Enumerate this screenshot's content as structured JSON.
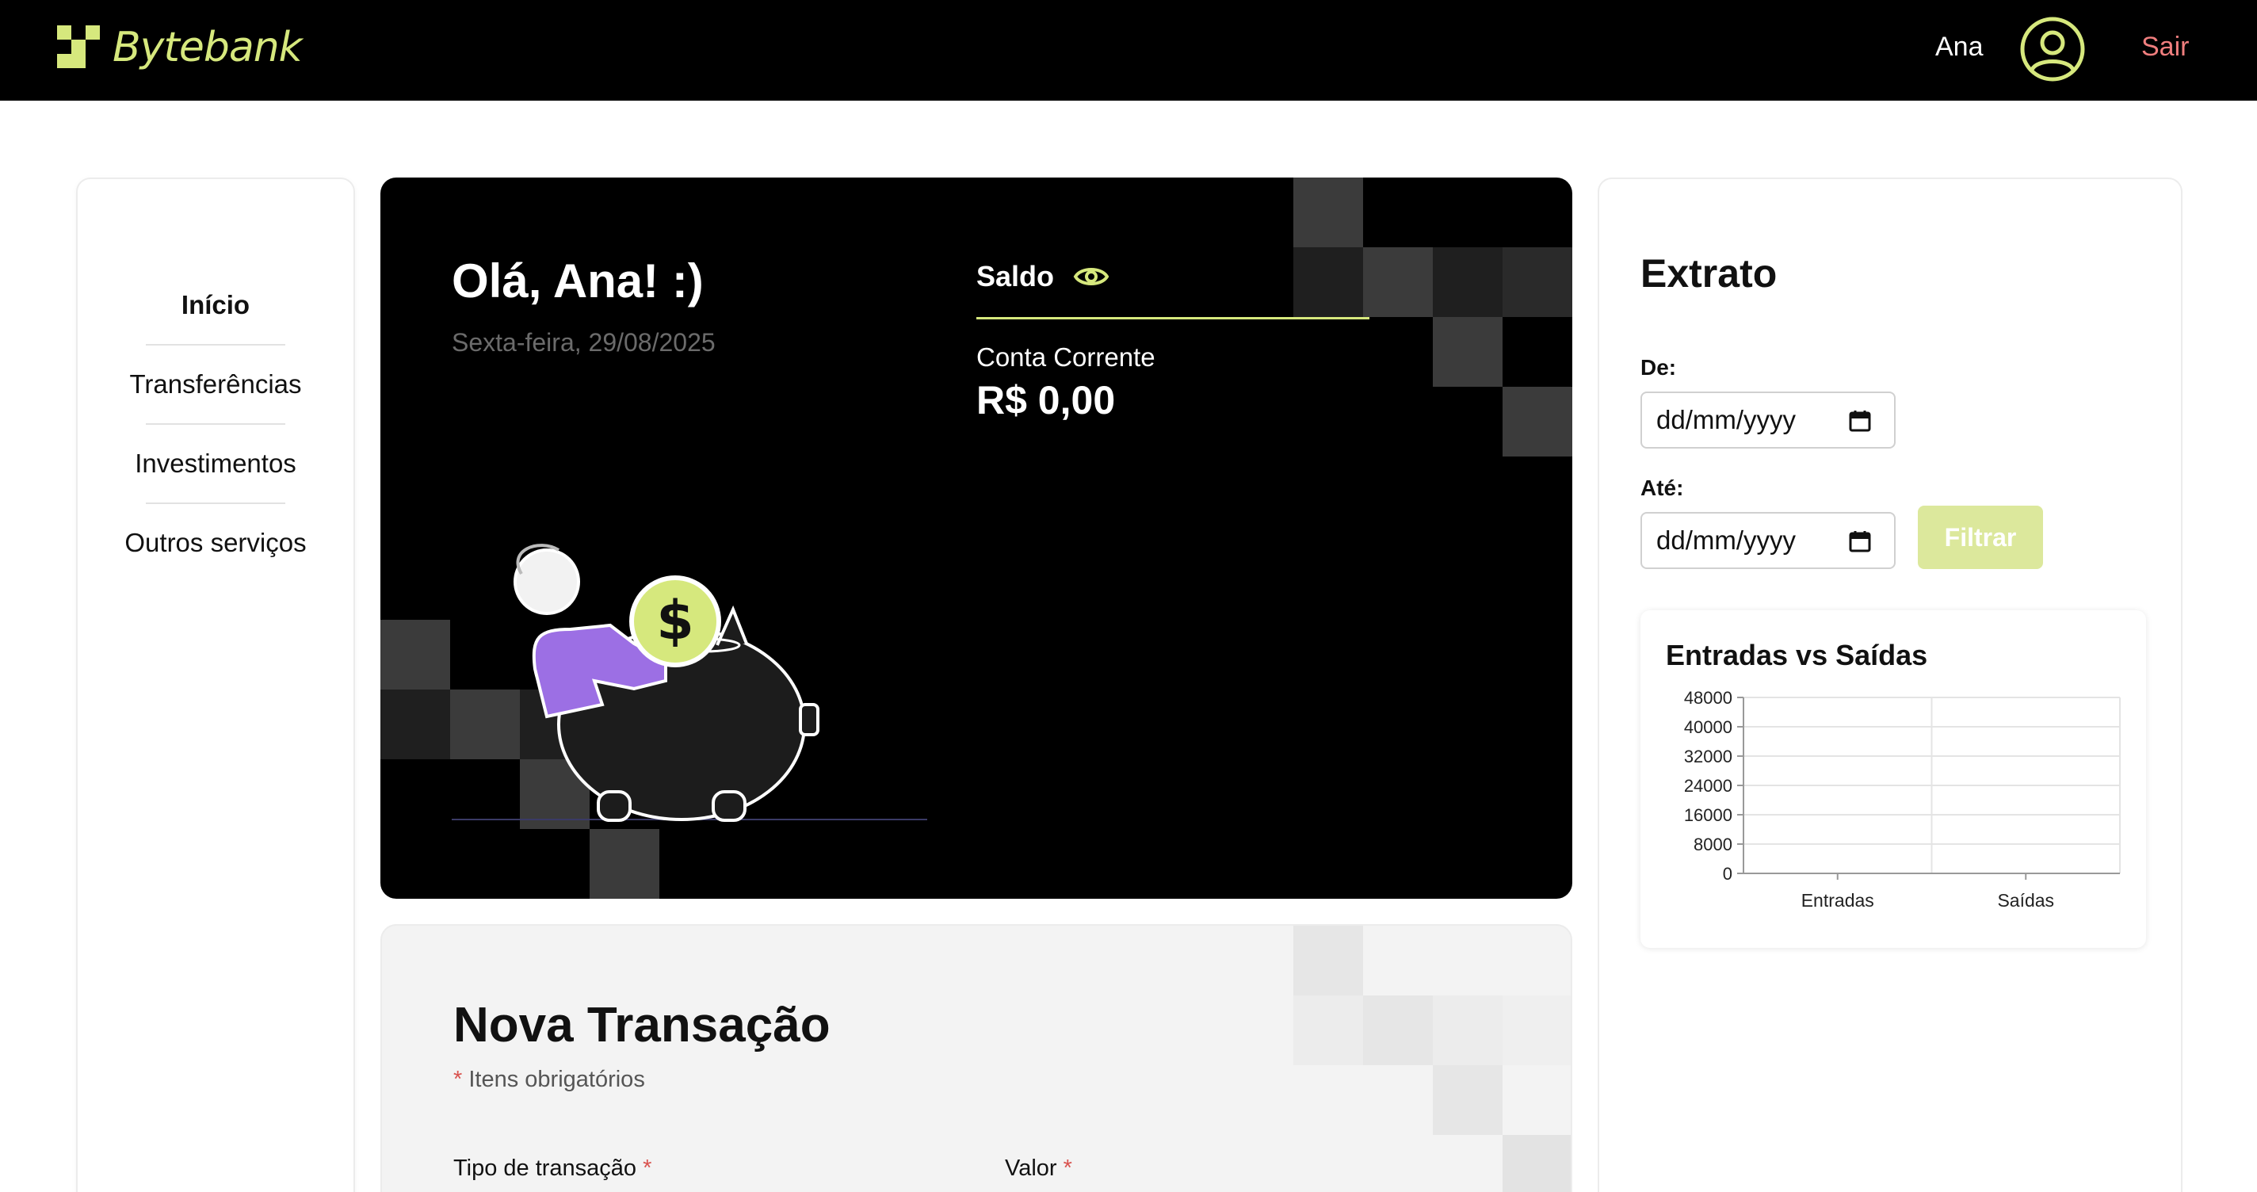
{
  "header": {
    "brand": "Bytebank",
    "user_name": "Ana",
    "logout_label": "Sair",
    "brand_color": "#d6e87d",
    "logout_color": "#f07e7e"
  },
  "sidebar": {
    "items": [
      {
        "label": "Início",
        "active": true
      },
      {
        "label": "Transferências",
        "active": false
      },
      {
        "label": "Investimentos",
        "active": false
      },
      {
        "label": "Outros serviços",
        "active": false
      }
    ]
  },
  "hero": {
    "greeting": "Olá, Ana! :)",
    "date": "Sexta-feira, 29/08/2025",
    "balance_label": "Saldo",
    "account_label": "Conta Corrente",
    "account_value": "R$ 0,00"
  },
  "transaction": {
    "title": "Nova Transação",
    "required_mark": "*",
    "required_note": "Itens obrigatórios",
    "type_label": "Tipo de transação",
    "value_label": "Valor"
  },
  "extrato": {
    "title": "Extrato",
    "from_label": "De:",
    "to_label": "Até:",
    "from_value": "dd/mm/yyyy",
    "to_value": "dd/mm/yyyy",
    "filter_label": "Filtrar"
  },
  "chart_data": {
    "type": "bar",
    "title": "Entradas vs Saídas",
    "categories": [
      "Entradas",
      "Saídas"
    ],
    "values": [
      0,
      0
    ],
    "yticks": [
      0,
      8000,
      16000,
      24000,
      32000,
      40000,
      48000
    ],
    "ylim": [
      0,
      48000
    ],
    "grid": true,
    "xlabel": "",
    "ylabel": ""
  }
}
